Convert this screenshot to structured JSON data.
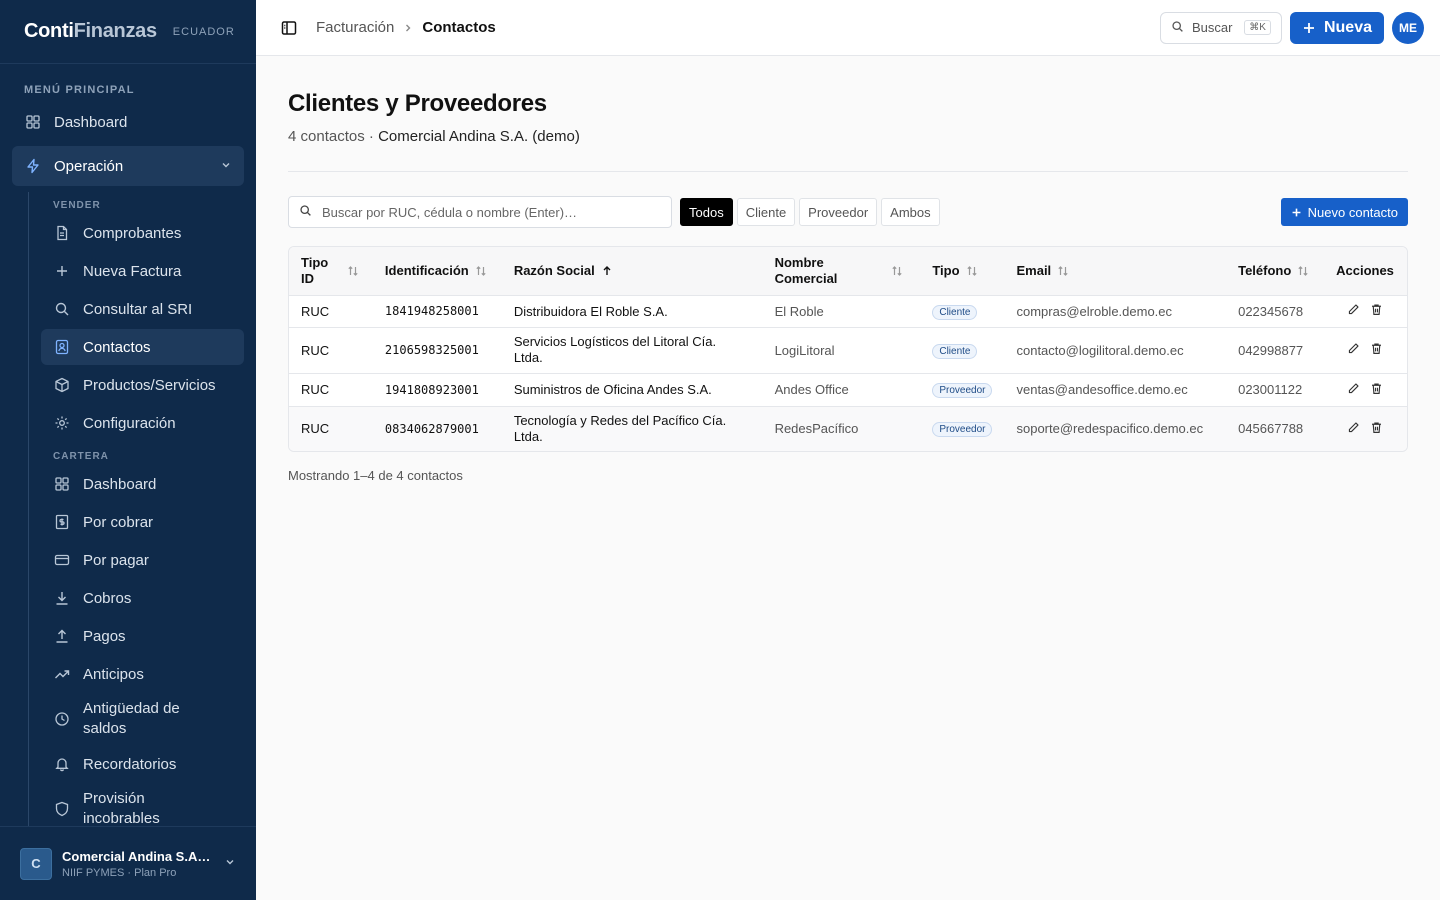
{
  "brand": {
    "name_bold": "Conti",
    "name_light": "Finanzas",
    "country": "ECUADOR"
  },
  "sidebar": {
    "section_label": "MENÚ PRINCIPAL",
    "dashboard": "Dashboard",
    "operacion": "Operación",
    "vender_label": "VENDER",
    "vender_items": [
      "Comprobantes",
      "Nueva Factura",
      "Consultar al SRI",
      "Contactos",
      "Productos/Servicios",
      "Configuración"
    ],
    "cartera_label": "CARTERA",
    "cartera_items": [
      "Dashboard",
      "Por cobrar",
      "Por pagar",
      "Cobros",
      "Pagos",
      "Anticipos",
      "Antigüedad de saldos",
      "Recordatorios",
      "Provisión incobrables"
    ]
  },
  "org": {
    "initial": "C",
    "name": "Comercial Andina S.A. (demo)",
    "plan": "NIIF PYMES · Plan Pro"
  },
  "topbar": {
    "crumb_parent": "Facturación",
    "crumb_current": "Contactos",
    "search_label": "Buscar",
    "search_kbd": "⌘K",
    "new_label": "Nueva",
    "avatar": "ME"
  },
  "page": {
    "title": "Clientes y Proveedores",
    "count": "4 contactos",
    "separator": "·",
    "company": "Comercial Andina S.A. (demo)"
  },
  "filters": {
    "search_placeholder": "Buscar por RUC, cédula o nombre (Enter)…",
    "chips": [
      "Todos",
      "Cliente",
      "Proveedor",
      "Ambos"
    ],
    "active_chip": "Todos",
    "add_label": "Nuevo contacto"
  },
  "table": {
    "headers": {
      "tipo_id": "Tipo ID",
      "identificacion": "Identificación",
      "razon_social": "Razón Social",
      "nombre_comercial": "Nombre Comercial",
      "tipo": "Tipo",
      "email": "Email",
      "telefono": "Teléfono",
      "acciones": "Acciones"
    },
    "rows": [
      {
        "tipo_id": "RUC",
        "identificacion": "1841948258001",
        "razon_social": "Distribuidora El Roble S.A.",
        "nombre_comercial": "El Roble",
        "tipo": "Cliente",
        "email": "compras@elroble.demo.ec",
        "telefono": "022345678"
      },
      {
        "tipo_id": "RUC",
        "identificacion": "2106598325001",
        "razon_social": "Servicios Logísticos del Litoral Cía. Ltda.",
        "nombre_comercial": "LogiLitoral",
        "tipo": "Cliente",
        "email": "contacto@logilitoral.demo.ec",
        "telefono": "042998877"
      },
      {
        "tipo_id": "RUC",
        "identificacion": "1941808923001",
        "razon_social": "Suministros de Oficina Andes S.A.",
        "nombre_comercial": "Andes Office",
        "tipo": "Proveedor",
        "email": "ventas@andesoffice.demo.ec",
        "telefono": "023001122"
      },
      {
        "tipo_id": "RUC",
        "identificacion": "0834062879001",
        "razon_social": "Tecnología y Redes del Pacífico Cía. Ltda.",
        "nombre_comercial": "RedesPacífico",
        "tipo": "Proveedor",
        "email": "soporte@redespacifico.demo.ec",
        "telefono": "045667788"
      }
    ]
  },
  "footer": {
    "showing": "Mostrando 1–4 de 4 contactos"
  },
  "colors": {
    "sidebar_bg": "#0f2a4a",
    "accent": "#1760c9",
    "active_chip": "#000000"
  }
}
